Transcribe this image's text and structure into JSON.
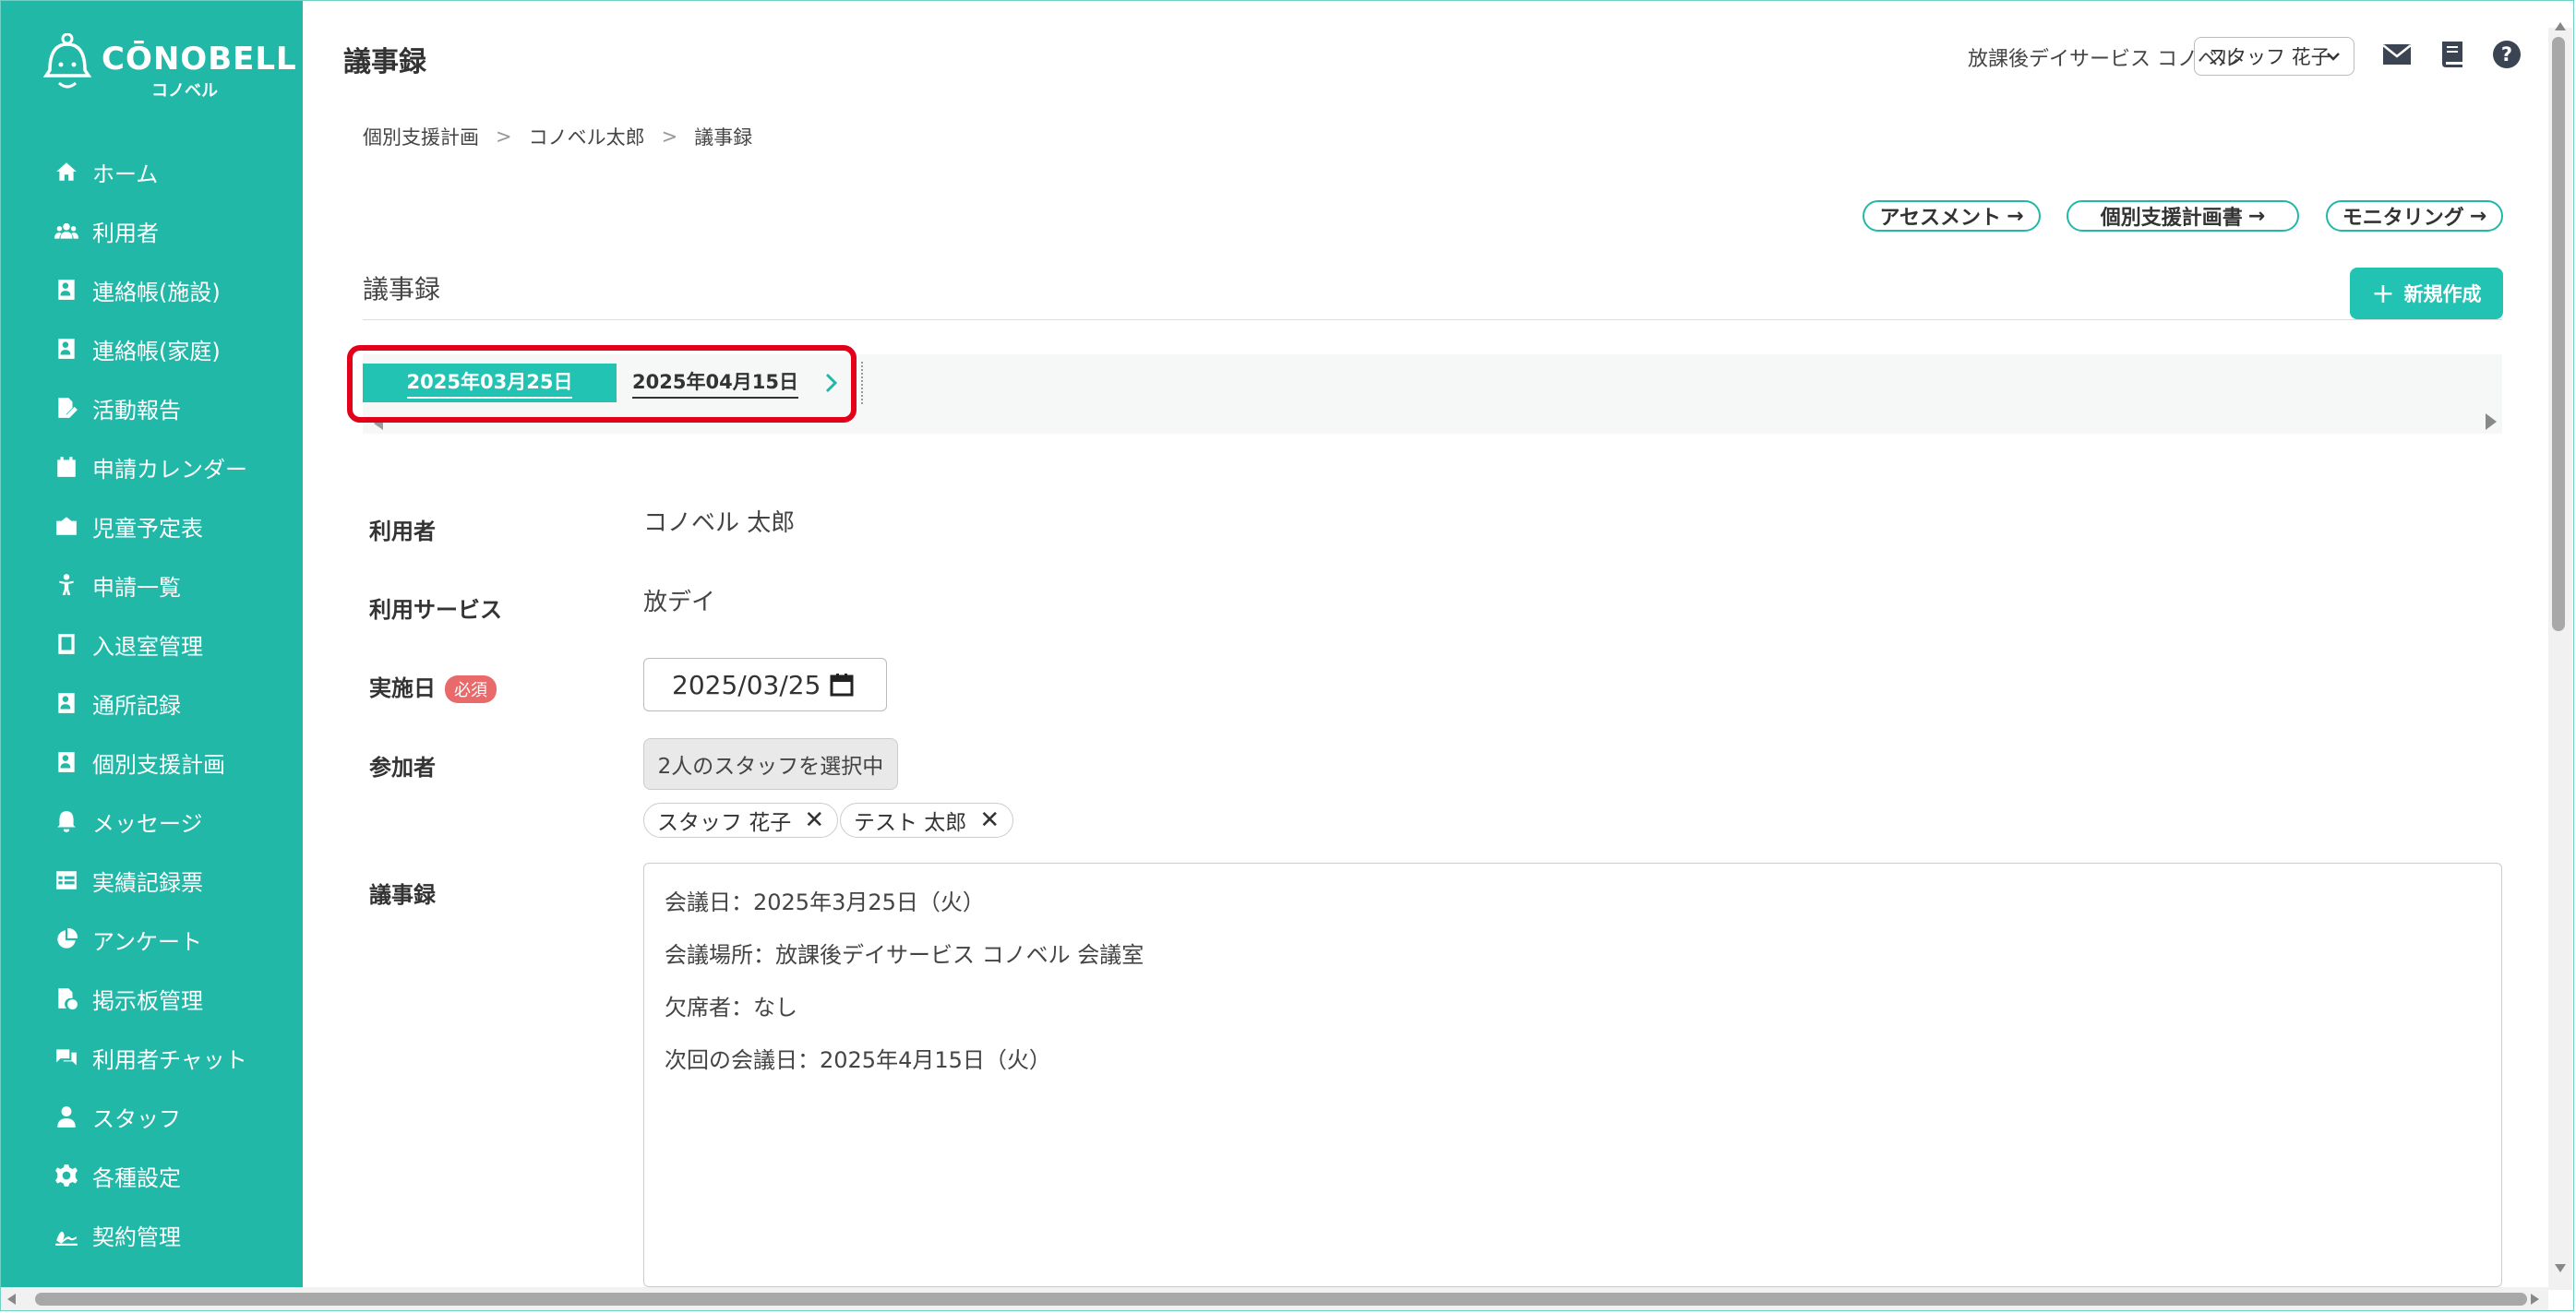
{
  "app": {
    "brand": "CŌNOBELL",
    "brand_sub": "コノベル"
  },
  "sidebar": {
    "items": [
      {
        "label": "ホーム",
        "icon": "home-icon"
      },
      {
        "label": "利用者",
        "icon": "users-icon"
      },
      {
        "label": "連絡帳(施設)",
        "icon": "contact-book-icon"
      },
      {
        "label": "連絡帳(家庭)",
        "icon": "contact-book-icon"
      },
      {
        "label": "活動報告",
        "icon": "file-edit-icon"
      },
      {
        "label": "申請カレンダー",
        "icon": "calendar-icon"
      },
      {
        "label": "児童予定表",
        "icon": "school-icon"
      },
      {
        "label": "申請一覧",
        "icon": "child-icon"
      },
      {
        "label": "入退室管理",
        "icon": "tablet-icon"
      },
      {
        "label": "通所記録",
        "icon": "contact-book-icon"
      },
      {
        "label": "個別支援計画",
        "icon": "contact-book-icon"
      },
      {
        "label": "メッセージ",
        "icon": "bell-icon"
      },
      {
        "label": "実績記録票",
        "icon": "table-icon"
      },
      {
        "label": "アンケート",
        "icon": "pie-chart-icon"
      },
      {
        "label": "掲示板管理",
        "icon": "file-check-icon"
      },
      {
        "label": "利用者チャット",
        "icon": "chat-icon"
      },
      {
        "label": "スタッフ",
        "icon": "staff-icon"
      },
      {
        "label": "各種設定",
        "icon": "gear-icon"
      },
      {
        "label": "契約管理",
        "icon": "signature-icon"
      }
    ]
  },
  "header": {
    "title": "議事録",
    "facility": "放課後デイサービス コノベル",
    "staff": "スタッフ 花子"
  },
  "breadcrumb": [
    "個別支援計画",
    "コノベル太郎",
    "議事録"
  ],
  "actions": {
    "assessment": "アセスメント",
    "support_plan": "個別支援計画書",
    "monitoring": "モニタリング",
    "arrow": "→"
  },
  "section": {
    "title": "議事録",
    "new_label": "新規作成"
  },
  "tabs": {
    "items": [
      "2025年03月25日",
      "2025年04月15日"
    ],
    "active_index": 0
  },
  "form": {
    "user_label": "利用者",
    "user_value": "コノベル 太郎",
    "service_label": "利用サービス",
    "service_value": "放デイ",
    "date_label": "実施日",
    "required_badge": "必須",
    "date_value": "2025/03/25",
    "participants_label": "参加者",
    "participants_button": "2人のスタッフを選択中",
    "participants": [
      "スタッフ 花子",
      "テスト 太郎"
    ],
    "minutes_label": "議事録",
    "minutes_lines": [
      "会議日：2025年3月25日（火）",
      "会議場所：放課後デイサービス コノベル 会議室",
      "欠席者：なし",
      "次回の会議日：2025年4月15日（火）"
    ]
  },
  "colors": {
    "accent": "#22b8a8",
    "highlight": "#e3001b",
    "required": "#e86a6a"
  }
}
